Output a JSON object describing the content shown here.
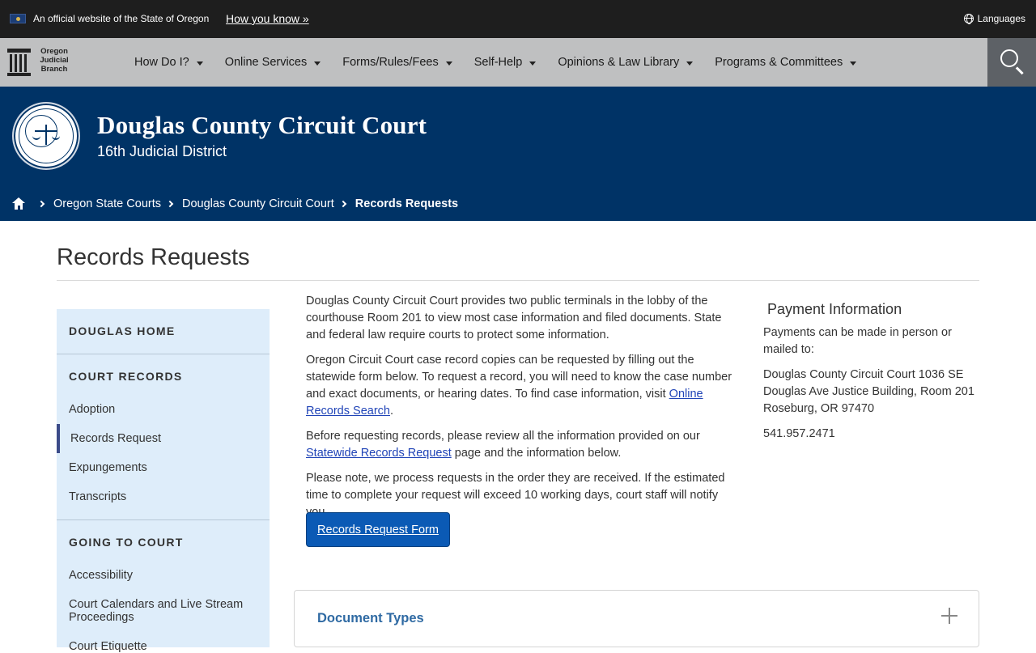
{
  "official_bar": {
    "text": "An official website of the State of Oregon",
    "how_link": "How you know »",
    "languages": "Languages"
  },
  "brand": {
    "line1": "Oregon",
    "line2": "Judicial",
    "line3": "Branch"
  },
  "nav": {
    "items": [
      {
        "label": "How Do I?"
      },
      {
        "label": "Online Services"
      },
      {
        "label": "Forms/Rules/Fees"
      },
      {
        "label": "Self-Help"
      },
      {
        "label": "Opinions & Law Library"
      },
      {
        "label": "Programs & Committees"
      }
    ]
  },
  "hero": {
    "title": "Douglas County Circuit Court",
    "subtitle": "16th Judicial District"
  },
  "breadcrumb": {
    "items": [
      "Oregon State Courts",
      "Douglas County Circuit Court"
    ],
    "current": "Records Requests"
  },
  "page": {
    "title": "Records Requests"
  },
  "sidebar": {
    "section1": "DOUGLAS HOME",
    "section2": "COURT RECORDS",
    "items2": [
      "Adoption",
      "Records Request",
      "Expungements",
      "Transcripts"
    ],
    "section3": "GOING TO COURT",
    "items3": [
      "Accessibility",
      "Court Calendars and Live Stream Proceedings",
      "Court Etiquette"
    ]
  },
  "main": {
    "p1": "Douglas County Circuit Court provides two public terminals in the lobby of the courthouse Room 201 to view most case information and filed documents. State and federal law require courts to protect some information.",
    "p2_pre": "Oregon Circuit Court case record copies can be requested by filling out the statewide form below. To request a record, you will need to know the case number and exact documents, or hearing dates. To find case information, visit ",
    "p2_link": "Online Records Search",
    "p2_post": ".",
    "p3_pre": "Before requesting records, please review all the information provided on our ",
    "p3_link": "Statewide Records Request",
    "p3_post": " page and the information below.",
    "p4": "Please note, we process requests in the order they are received. If the estimated time to complete your request will exceed 10 working days, court staff will notify you.",
    "cta": "Records Request Form"
  },
  "aside": {
    "heading": "Payment Information",
    "p1": "Payments can be made in person or mailed to:",
    "address1": "Douglas County Circuit Court 1036 SE Douglas Ave Justice Building, Room 201",
    "address2": "Roseburg, OR 97470",
    "phone": "541.957.2471"
  },
  "accordion": {
    "label": "Document Types"
  },
  "colors": {
    "hero_bg": "#003366",
    "nav_bg": "#bfc0c1",
    "top_bar": "#1e1e1e",
    "sidebar_bg": "#deedfa",
    "cta_bg": "#0b5ab5",
    "link": "#2044b7"
  }
}
